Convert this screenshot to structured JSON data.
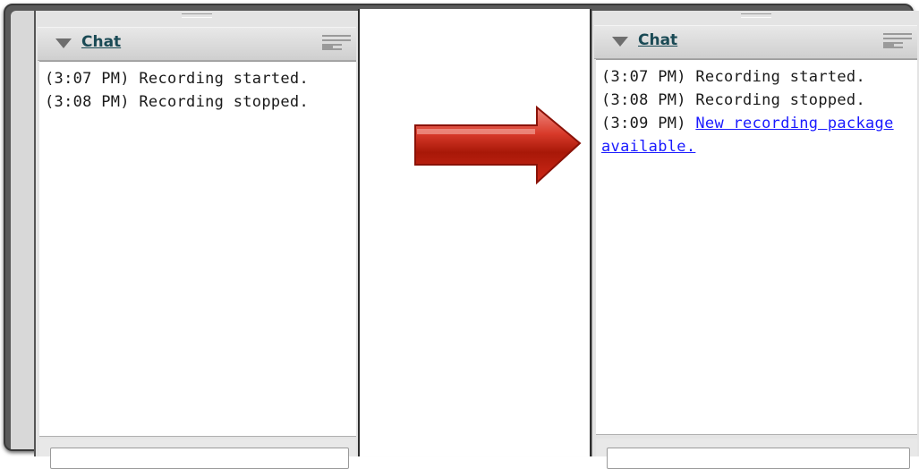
{
  "left_pod": {
    "title": "Chat",
    "messages": [
      {
        "time": "(3:07 PM)",
        "text": "Recording started."
      },
      {
        "time": "(3:08 PM)",
        "text": "Recording stopped."
      }
    ]
  },
  "right_pod": {
    "title": "Chat",
    "messages": [
      {
        "time": "(3:07 PM)",
        "text": "Recording started."
      },
      {
        "time": "(3:08 PM)",
        "text": "Recording stopped."
      },
      {
        "time": "(3:09 PM)",
        "link_text": "New recording package available."
      }
    ]
  },
  "colors": {
    "title": "#1a4a55",
    "link": "#1a1aff",
    "arrow": "#c8281c"
  },
  "icons": [
    "collapse-triangle-icon",
    "pod-menu-icon",
    "right-arrow-icon"
  ]
}
